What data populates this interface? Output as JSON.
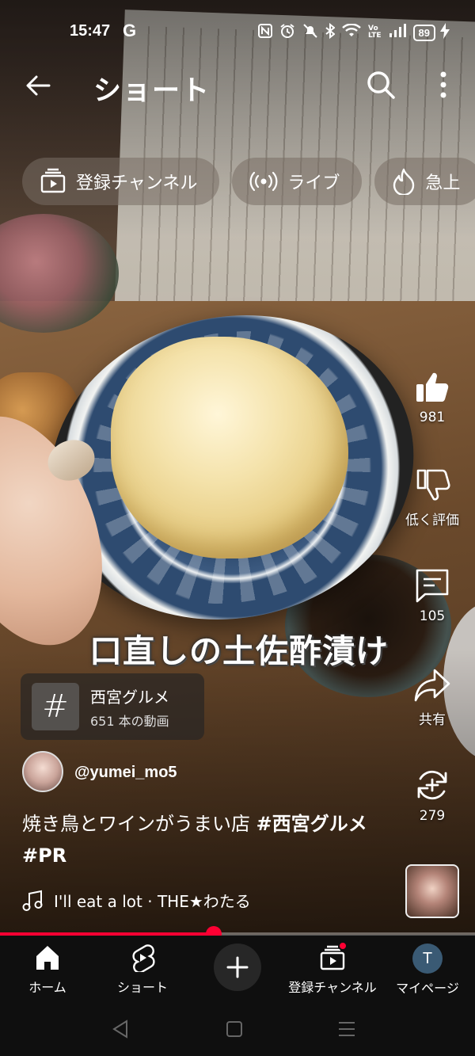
{
  "status_bar": {
    "time": "15:47",
    "g_icon": "G",
    "battery": "89",
    "icons": [
      "nfc-icon",
      "alarm-icon",
      "mute-icon",
      "bluetooth-icon",
      "wifi-icon",
      "volte-icon",
      "signal-icon",
      "battery-icon",
      "charging-icon"
    ]
  },
  "app_bar": {
    "title": "ショート"
  },
  "chips": [
    {
      "label": "登録チャンネル",
      "icon": "subscriptions-icon"
    },
    {
      "label": "ライブ",
      "icon": "live-icon"
    },
    {
      "label": "急上",
      "icon": "trending-icon"
    }
  ],
  "video": {
    "caption": "口直しの土佐酢漬け"
  },
  "actions": {
    "like": {
      "label": "981",
      "icon": "thumbs-up-icon"
    },
    "dislike": {
      "label": "低く評価",
      "icon": "thumbs-down-icon"
    },
    "comments": {
      "label": "105",
      "icon": "comment-icon"
    },
    "share": {
      "label": "共有",
      "icon": "share-icon"
    },
    "remix": {
      "label": "279",
      "icon": "remix-icon"
    }
  },
  "hashtag_card": {
    "symbol": "#",
    "title": "西宮グルメ",
    "count": "651 本の動画"
  },
  "channel": {
    "name": "@yumei_mo5"
  },
  "description": {
    "text": "焼き鳥とワインがうまい店 ",
    "tags": "#西宮グルメ #PR"
  },
  "music": {
    "text": "I'll eat a lot · THE★わたる"
  },
  "progress": {
    "fraction": 0.45
  },
  "bottom_nav": [
    {
      "label": "ホーム",
      "icon": "home-icon"
    },
    {
      "label": "ショート",
      "icon": "shorts-icon"
    },
    {
      "label": "",
      "icon": "create-icon"
    },
    {
      "label": "登録チャンネル",
      "icon": "subscriptions-icon"
    },
    {
      "label": "マイページ",
      "icon": "avatar",
      "initial": "T"
    }
  ],
  "colors": {
    "accent_red": "#ff0033",
    "nav_background": "#0f0f0f"
  }
}
